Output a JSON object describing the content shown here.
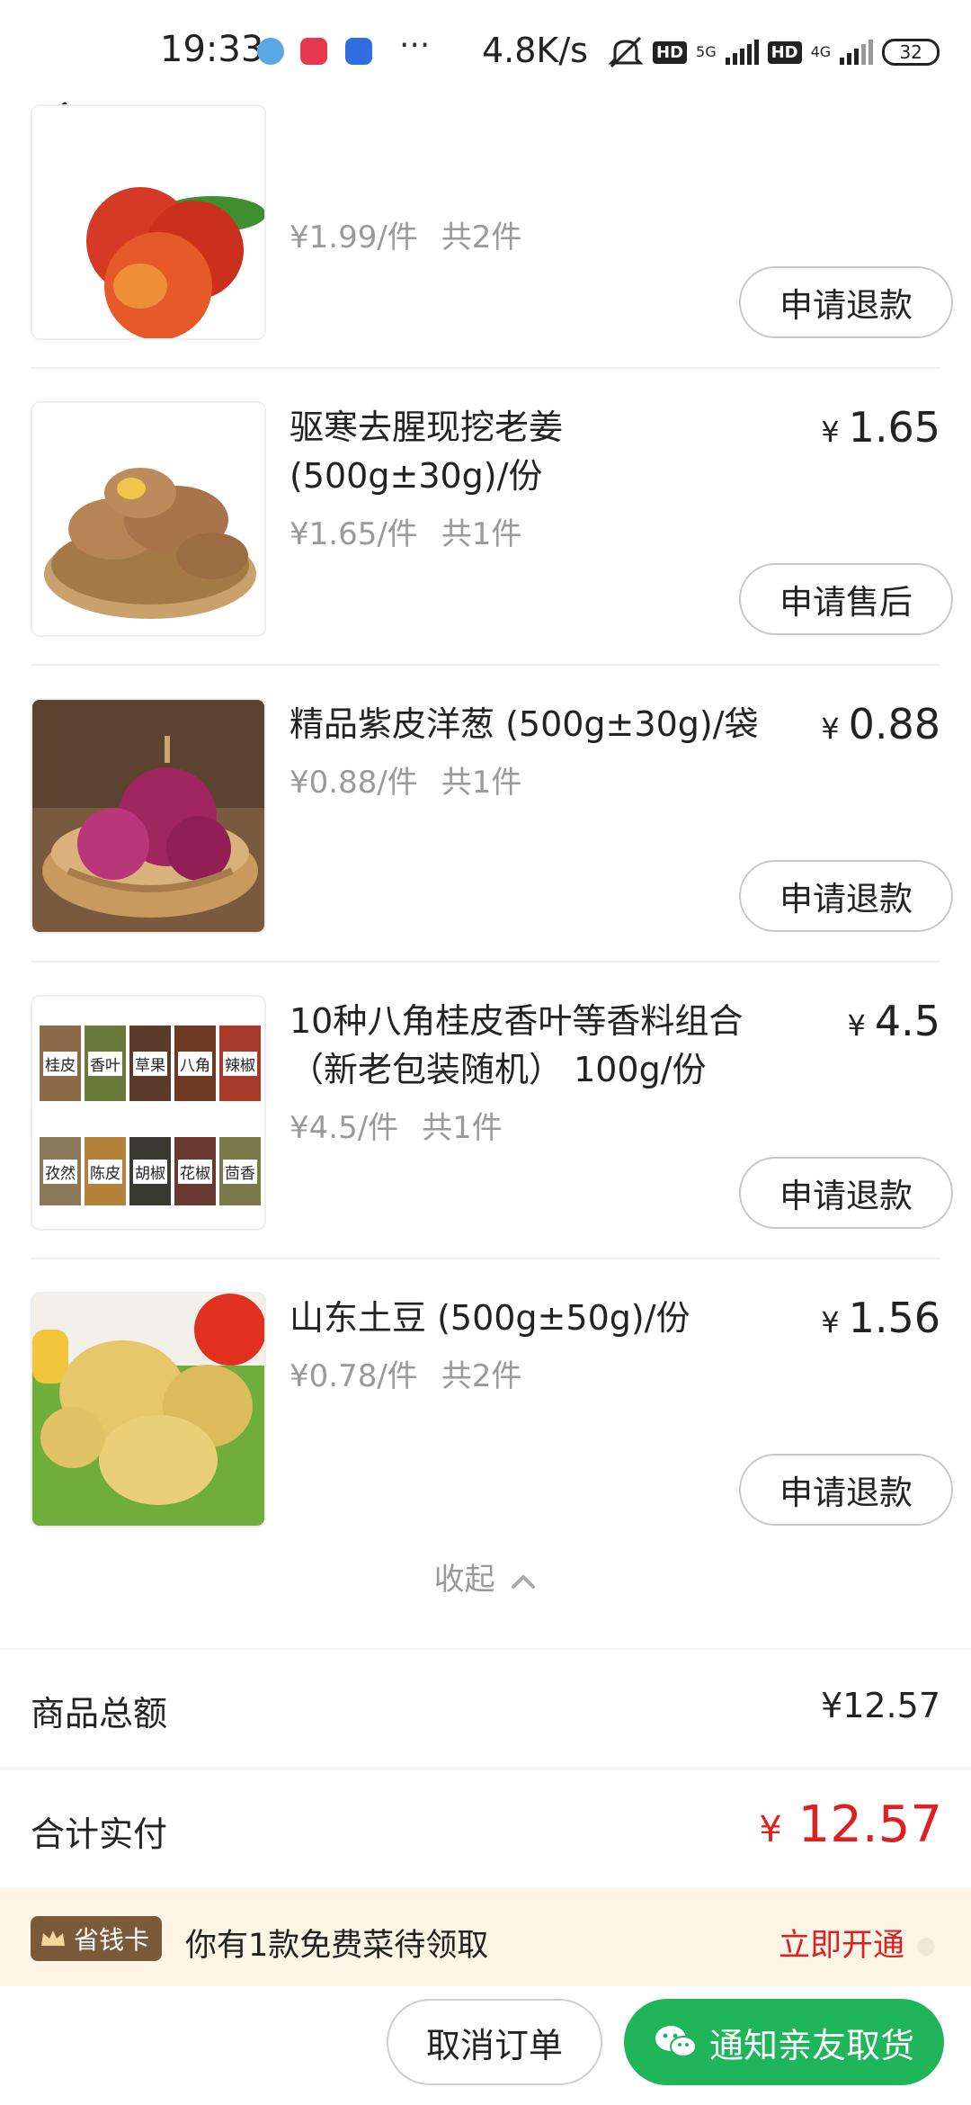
{
  "status_bar": {
    "time": "19:33",
    "dots": "···",
    "speed": "4.8K/s",
    "hd1": "HD",
    "net1": "5G",
    "hd2": "HD",
    "net2": "4G",
    "battery": "32"
  },
  "nav": {
    "back_icon": "chevron-left-icon"
  },
  "items": [
    {
      "name": "",
      "unit_price": "¥1.99/件",
      "qty": "共2件",
      "price": "",
      "action": "申请退款",
      "image": "peach-image"
    },
    {
      "name": "驱寒去腥现挖老姜 (500g±30g)/份",
      "unit_price": "¥1.65/件",
      "qty": "共1件",
      "price": "1.65",
      "action": "申请售后",
      "image": "ginger-image"
    },
    {
      "name": "精品紫皮洋葱 (500g±30g)/袋",
      "unit_price": "¥0.88/件",
      "qty": "共1件",
      "price": "0.88",
      "action": "申请退款",
      "image": "onion-image"
    },
    {
      "name": "10种八角桂皮香叶等香料组合（新老包装随机） 100g/份",
      "unit_price": "¥4.5/件",
      "qty": "共1件",
      "price": "4.5",
      "action": "申请退款",
      "image": "spices-image",
      "spice_labels_top": [
        "桂皮",
        "香叶",
        "草果",
        "八角",
        "辣椒"
      ],
      "spice_labels_bottom": [
        "孜然",
        "陈皮",
        "胡椒",
        "花椒",
        "茴香"
      ]
    },
    {
      "name": "山东土豆 (500g±50g)/份",
      "unit_price": "¥0.78/件",
      "qty": "共2件",
      "price": "1.56",
      "action": "申请退款",
      "image": "potato-image"
    }
  ],
  "currency_symbol": "¥",
  "collapse_label": "收起",
  "summary": {
    "goods_total_label": "商品总额",
    "goods_total_value": "¥12.57",
    "paid_label": "合计实付",
    "paid_value": "12.57"
  },
  "promo": {
    "badge": "省钱卡",
    "text": "你有1款免费菜待领取",
    "action": "立即开通"
  },
  "bottom": {
    "cancel": "取消订单",
    "notify": "通知亲友取货"
  },
  "colors": {
    "accent_red": "#e02020",
    "wechat_green": "#1fb55a",
    "promo_bg": "#fdf6e6"
  }
}
